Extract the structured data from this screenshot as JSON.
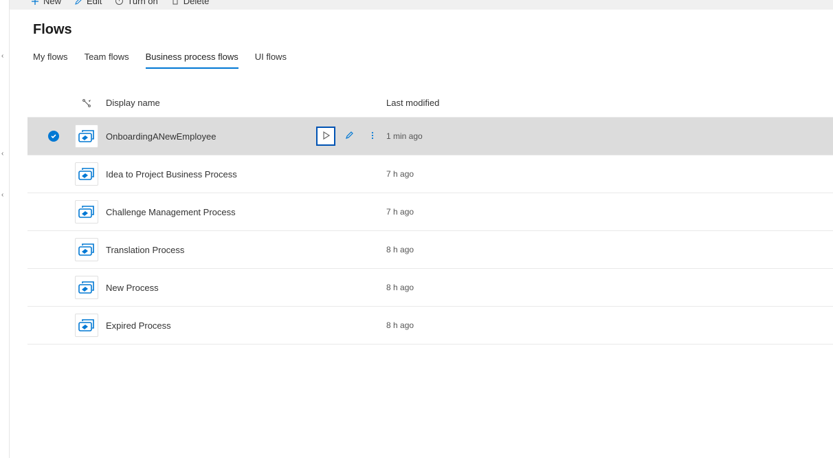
{
  "toolbar": {
    "new": "New",
    "edit": "Edit",
    "turn_on": "Turn on",
    "delete": "Delete"
  },
  "page_title": "Flows",
  "tabs": {
    "my": "My flows",
    "team": "Team flows",
    "bpf": "Business process flows",
    "ui": "UI flows"
  },
  "columns": {
    "display_name": "Display name",
    "last_modified": "Last modified"
  },
  "rows": [
    {
      "name": "OnboardingANewEmployee",
      "modified": "1 min ago",
      "selected": true,
      "show_actions": true
    },
    {
      "name": "Idea to Project Business Process",
      "modified": "7 h ago",
      "selected": false,
      "show_actions": false
    },
    {
      "name": "Challenge Management Process",
      "modified": "7 h ago",
      "selected": false,
      "show_actions": false
    },
    {
      "name": "Translation Process",
      "modified": "8 h ago",
      "selected": false,
      "show_actions": false
    },
    {
      "name": "New Process",
      "modified": "8 h ago",
      "selected": false,
      "show_actions": false
    },
    {
      "name": "Expired Process",
      "modified": "8 h ago",
      "selected": false,
      "show_actions": false
    }
  ]
}
